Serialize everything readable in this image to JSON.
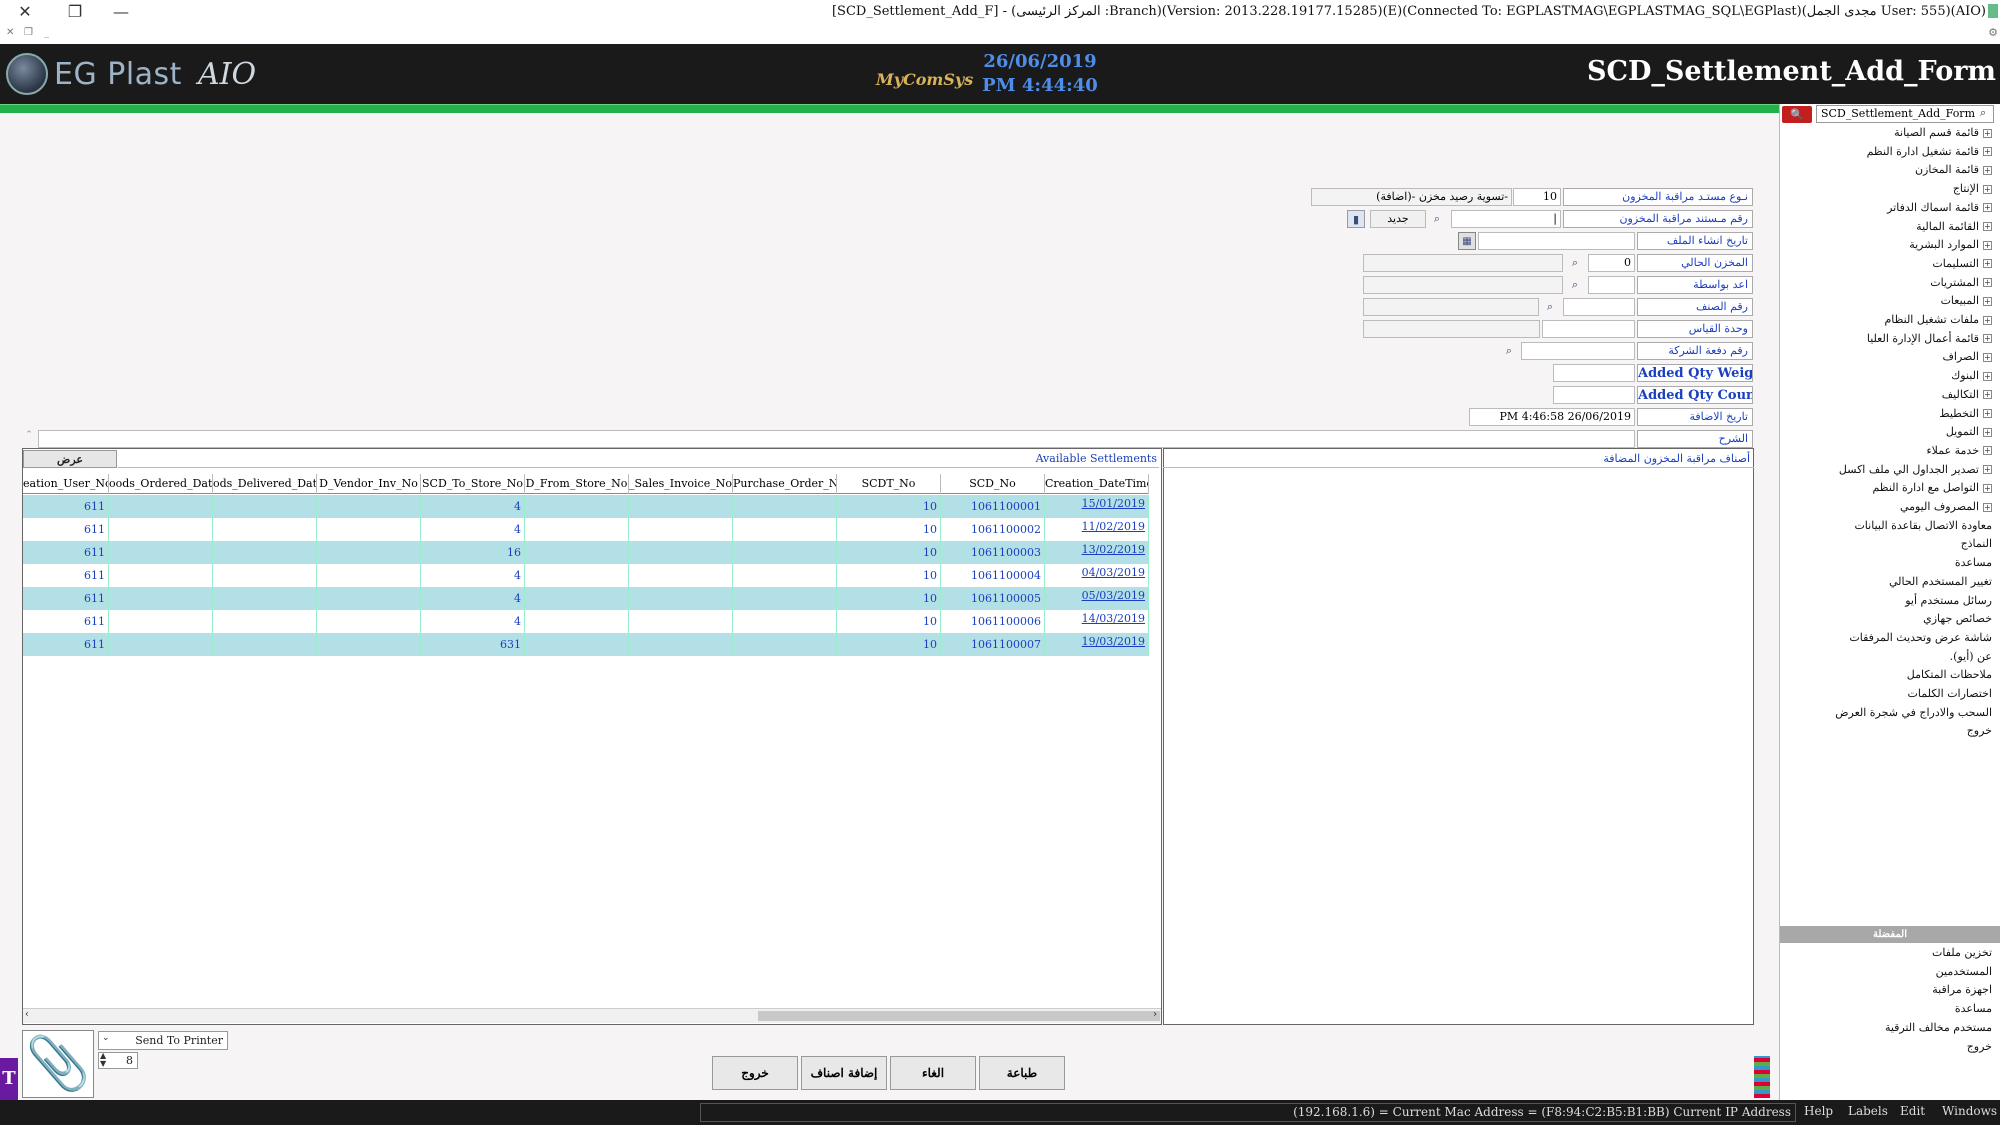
{
  "window": {
    "title": "[SCD_Settlement_Add_F] - (المركز الرئيسى :Branch)(Version: 2013.228.19177.15285)(E)(Connected To: EGPLASTMAG\\EGPLASTMAG_SQL\\EGPlast)(مجدى الجمل User: 555)(AIO)",
    "close": "✕",
    "restore": "❐",
    "minimize": "—"
  },
  "header": {
    "brand": "EG Plast",
    "brand_suffix": "AIO",
    "vendor": "MyComSys",
    "date": "26/06/2019",
    "time": "PM 4:44:40",
    "form_title": "SCD_Settlement_Add_Form"
  },
  "colors": {
    "header_bg": "#1a1a1a",
    "accent_green": "#22b14c",
    "label_blue": "#1a3fbf",
    "row_alt": "#b3dfe6",
    "search_red": "#c41f1f"
  },
  "right_panel": {
    "search_value": "SCD_Settlement_Add_Form",
    "tree": [
      {
        "label": "قائمة قسم الصيانة",
        "expandable": true
      },
      {
        "label": "قائمة تشغيل ادارة النظم",
        "expandable": true
      },
      {
        "label": "قائمة المخازن",
        "expandable": true
      },
      {
        "label": "الإنتاج",
        "expandable": true
      },
      {
        "label": "قائمة اسماك الدفاتر",
        "expandable": true
      },
      {
        "label": "القائمة المالية",
        "expandable": true
      },
      {
        "label": "الموارد البشرية",
        "expandable": true
      },
      {
        "label": "التسليمات",
        "expandable": true
      },
      {
        "label": "المشتريات",
        "expandable": true
      },
      {
        "label": "المبيعات",
        "expandable": true
      },
      {
        "label": "ملفات تشغيل النظام",
        "expandable": true
      },
      {
        "label": "قائمة أعمال الإدارة العليا",
        "expandable": true
      },
      {
        "label": "الصراف",
        "expandable": true
      },
      {
        "label": "البنوك",
        "expandable": true
      },
      {
        "label": "التكاليف",
        "expandable": true
      },
      {
        "label": "التخطيط",
        "expandable": true
      },
      {
        "label": "التمويل",
        "expandable": true
      },
      {
        "label": "خدمة عملاء",
        "expandable": true
      },
      {
        "label": "تصدير الجداول الي ملف اكسل",
        "expandable": true
      },
      {
        "label": "التواصل مع ادارة النظم",
        "expandable": true
      },
      {
        "label": "المصروف اليومي",
        "expandable": true
      },
      {
        "label": "معاودة الاتصال بقاعدة البيانات",
        "expandable": false
      },
      {
        "label": "النماذج",
        "expandable": false
      },
      {
        "label": "مساعدة",
        "expandable": false
      },
      {
        "label": "تغيير المستخدم الحالي",
        "expandable": false
      },
      {
        "label": "رسائل مستخدم أيو",
        "expandable": false
      },
      {
        "label": "خصائص جهازي",
        "expandable": false
      },
      {
        "label": "شاشة عرض وتحديث المرفقات",
        "expandable": false
      },
      {
        "label": "عن (أيو).",
        "expandable": false
      },
      {
        "label": "ملاحظات المتكامل",
        "expandable": false
      },
      {
        "label": "اختصارات الكلمات",
        "expandable": false
      },
      {
        "label": "السحب والادراج في شجرة العرض",
        "expandable": false
      },
      {
        "label": "خروج",
        "expandable": false
      }
    ],
    "favorites_title": "المفضلة",
    "favorites": [
      "تخزين ملفات",
      "المستخدمين",
      "اجهزة مراقبة",
      "مساعدة",
      "مستخدم مخالف الترقية",
      "خروج"
    ]
  },
  "form": {
    "doc_type_label": "نـوع مستـد مراقبة المخزون",
    "doc_type_code": "10",
    "doc_type_name": "تسوية رصيد مخزن -(اضافة)-",
    "doc_no_label": "رقم مـستند مراقبة المخزون",
    "doc_no_value": "|",
    "new_label": "جديد",
    "created_date_label": "تاريخ انشاء الملف",
    "current_store_label": "المخزن الحالي",
    "current_store_value": "0",
    "prepared_by_label": "اعد بواسطة",
    "item_no_label": "رقم الصنف",
    "unit_label": "وحدة القياس",
    "batch_no_label": "رقم دفعة الشركة",
    "added_qty_weight_label": "Added Qty Weight",
    "added_qty_count_label": "Added Qty Count",
    "added_date_label": "تاريخ الاضافة",
    "added_date_value": "PM 4:46:58 26/06/2019",
    "notes_label": "الشرح"
  },
  "grid": {
    "show_button": "عرض",
    "title": "Available Settlements",
    "columns": [
      "eation_User_No",
      "oods_Ordered_Date",
      "ods_Delivered_Date",
      "D_Vendor_Inv_No",
      "SCD_To_Store_No",
      "D_From_Store_No",
      "_Sales_Invoice_No",
      "Purchase_Order_No",
      "SCDT_No",
      "SCD_No",
      "Creation_DateTime"
    ],
    "rows": [
      {
        "user": "611",
        "to_store": "4",
        "scdt": "10",
        "scd": "1061100001",
        "date": "15/01/2019"
      },
      {
        "user": "611",
        "to_store": "4",
        "scdt": "10",
        "scd": "1061100002",
        "date": "11/02/2019"
      },
      {
        "user": "611",
        "to_store": "16",
        "scdt": "10",
        "scd": "1061100003",
        "date": "13/02/2019"
      },
      {
        "user": "611",
        "to_store": "4",
        "scdt": "10",
        "scd": "1061100004",
        "date": "04/03/2019"
      },
      {
        "user": "611",
        "to_store": "4",
        "scdt": "10",
        "scd": "1061100005",
        "date": "05/03/2019"
      },
      {
        "user": "611",
        "to_store": "4",
        "scdt": "10",
        "scd": "1061100006",
        "date": "14/03/2019"
      },
      {
        "user": "611",
        "to_store": "631",
        "scdt": "10",
        "scd": "1061100007",
        "date": "19/03/2019"
      }
    ]
  },
  "items_panel": {
    "title": "أصناف مراقبة المخزون المضافة"
  },
  "footer": {
    "print": "طباعة",
    "cancel": "الغاء",
    "add_items": "إضافة اصناف",
    "exit": "خروج",
    "printer_option": "Send To Printer",
    "copies": "8"
  },
  "statusbar": {
    "text": "(192.168.1.6) = Current Mac Address = (F8:94:C2:B5:B1:BB) Current IP Address",
    "menus": [
      "Help",
      "Labels",
      "Edit",
      "Windows"
    ]
  }
}
